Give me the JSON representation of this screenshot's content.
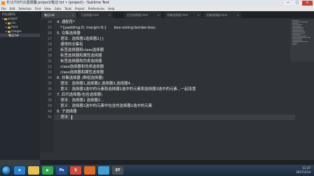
{
  "window": {
    "title": "E:\\17\\07\\1\\选择器.project\\笔记.txt • (project) - Sublime Text",
    "buttons": [
      "—",
      "□",
      "✕"
    ]
  },
  "menu": [
    "File",
    "Edit",
    "Selection",
    "Find",
    "View",
    "Goto",
    "Tools",
    "Project",
    "Preferences",
    "Help"
  ],
  "sidebar": {
    "items": [
      {
        "label": "FOLDERS",
        "kind": "header"
      },
      {
        "label": "project",
        "kind": "folder"
      },
      {
        "label": "css",
        "kind": "folder"
      },
      {
        "label": "html",
        "kind": "folder"
      },
      {
        "label": "images",
        "kind": "folder"
      },
      {
        "label": "笔记.txt",
        "kind": "file"
      }
    ]
  },
  "tabs": [
    {
      "label": "笔记.txt",
      "active": true
    },
    {
      "label": "子选择器.html",
      "active": false
    },
    {
      "label": "后代选择器.html",
      "active": false
    },
    {
      "label": "并集选择器.html",
      "active": false
    },
    {
      "label": "交集选择器.html",
      "active": false
    }
  ],
  "editor": {
    "lines": [
      {
        "num": "24",
        "text": "4. 通配符*"
      },
      {
        "num": "25",
        "text": "   *{padding:0; margin:0;}      box-sizing:border-box;"
      },
      {
        "num": "26",
        "text": "5. 交集选择器"
      },
      {
        "num": "27",
        "text": "   语法：选择器1选择器2{}"
      },
      {
        "num": "28",
        "text": "   通常的交集有"
      },
      {
        "num": "29",
        "text": "   标签选择器和class选择器"
      },
      {
        "num": "30",
        "text": "   标签选择器和属性选择器"
      },
      {
        "num": "31",
        "text": "   标签选择器和伪类选择器"
      },
      {
        "num": "32",
        "text": "   class选择器和伪类选择器"
      },
      {
        "num": "33",
        "text": "   class选择器和属性选择器"
      },
      {
        "num": "34",
        "text": "6. 并集选择器 (群组选择器)"
      },
      {
        "num": "35",
        "text": "   语法：选择器1,选择器2,选择器3,选择器4..."
      },
      {
        "num": "36",
        "text": "   意义：选择器1选中的元素和选择器2选中的元素和选择器3选中的元素...一起设置"
      },
      {
        "num": "37",
        "text": "7. 后代选择器(包含选择器)"
      },
      {
        "num": "38",
        "text": "   语法：选择器1 选择器2..."
      },
      {
        "num": "39",
        "text": "   意义：选择器1选中的元素中包含的选择器2选中的元素"
      },
      {
        "num": "40",
        "text": "8. 子选择器"
      },
      {
        "num": "41",
        "text": "   语法：",
        "current": true
      }
    ]
  },
  "taskbar": {
    "apps": [
      {
        "label": "e",
        "color": "#2a7fd4"
      },
      {
        "label": "",
        "color": "#e8c24a"
      },
      {
        "label": "▶",
        "color": "#2fa84f"
      },
      {
        "label": "Ps",
        "color": "#1f4f8a"
      },
      {
        "label": "S",
        "color": "#d44a3a"
      },
      {
        "label": "",
        "color": "#e06a1f"
      },
      {
        "label": "",
        "color": "#3fa0d8"
      },
      {
        "label": "ST",
        "color": "#4a4f55"
      }
    ],
    "time": "11:37",
    "date": "2017/1/14"
  }
}
